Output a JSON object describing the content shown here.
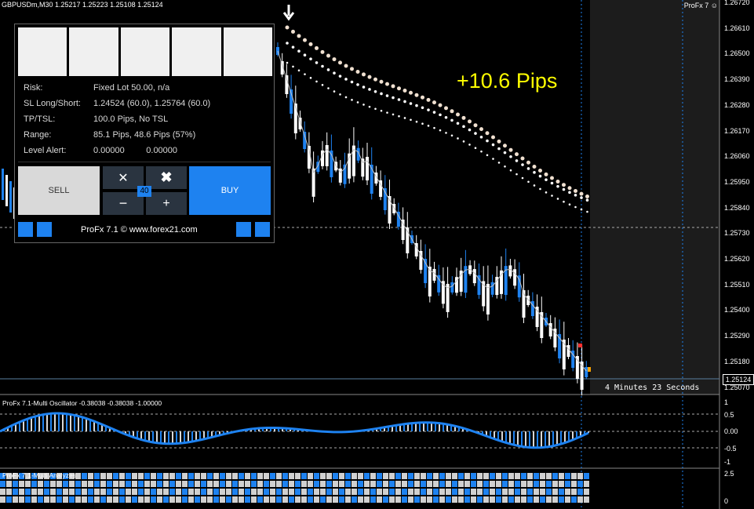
{
  "header": {
    "symbol_line": "GBPUSDm,M30  1.25217 1.25223 1.25108 1.25124",
    "indicator_tag": "ProFx 7 ☺"
  },
  "price_axis": [
    "1.26720",
    "1.26610",
    "1.26500",
    "1.26390",
    "1.26280",
    "1.26170",
    "1.26060",
    "1.25950",
    "1.25840",
    "1.25730",
    "1.25620",
    "1.25510",
    "1.25400",
    "1.25290",
    "1.25180",
    "1.25070"
  ],
  "current_price": "1.25124",
  "profit_label": "+10.6 Pips",
  "countdown": "4 Minutes 23 Seconds",
  "oscillator": {
    "title": "ProFx 7.1-Multi Oscillator -0.38038 -0.38038 -1.00000",
    "levels": [
      "1",
      "0.5",
      "0.00",
      "-0.5",
      "-1"
    ]
  },
  "analyzer": {
    "title": "ProFx 7.1-Multi Analyzes",
    "levels": [
      "2.5",
      "0"
    ]
  },
  "panel": {
    "rows": [
      {
        "label": "Risk:",
        "value": "Fixed Lot 50.00, n/a"
      },
      {
        "label": "SL Long/Short:",
        "value": "1.24524 (60.0), 1.25764 (60.0)"
      },
      {
        "label": "TP/TSL:",
        "value": "100.0 Pips, No TSL"
      },
      {
        "label": "Range:",
        "value": "85.1 Pips, 48.6 Pips (57%)"
      },
      {
        "label": "Level Alert:",
        "value": "0.00000         0.00000"
      }
    ],
    "sell_label": "SELL",
    "buy_label": "BUY",
    "volume": "40",
    "minus_label": "−",
    "plus_label": "+",
    "close_label": "✕",
    "close_all_label": "✖",
    "footer": "ProFx 7.1 © www.forex21.com"
  },
  "colors": {
    "bull": "#1e82f0",
    "bear": "#ffffff",
    "accent_yellow": "#ffff00",
    "panel_blue": "#1e82f0"
  }
}
